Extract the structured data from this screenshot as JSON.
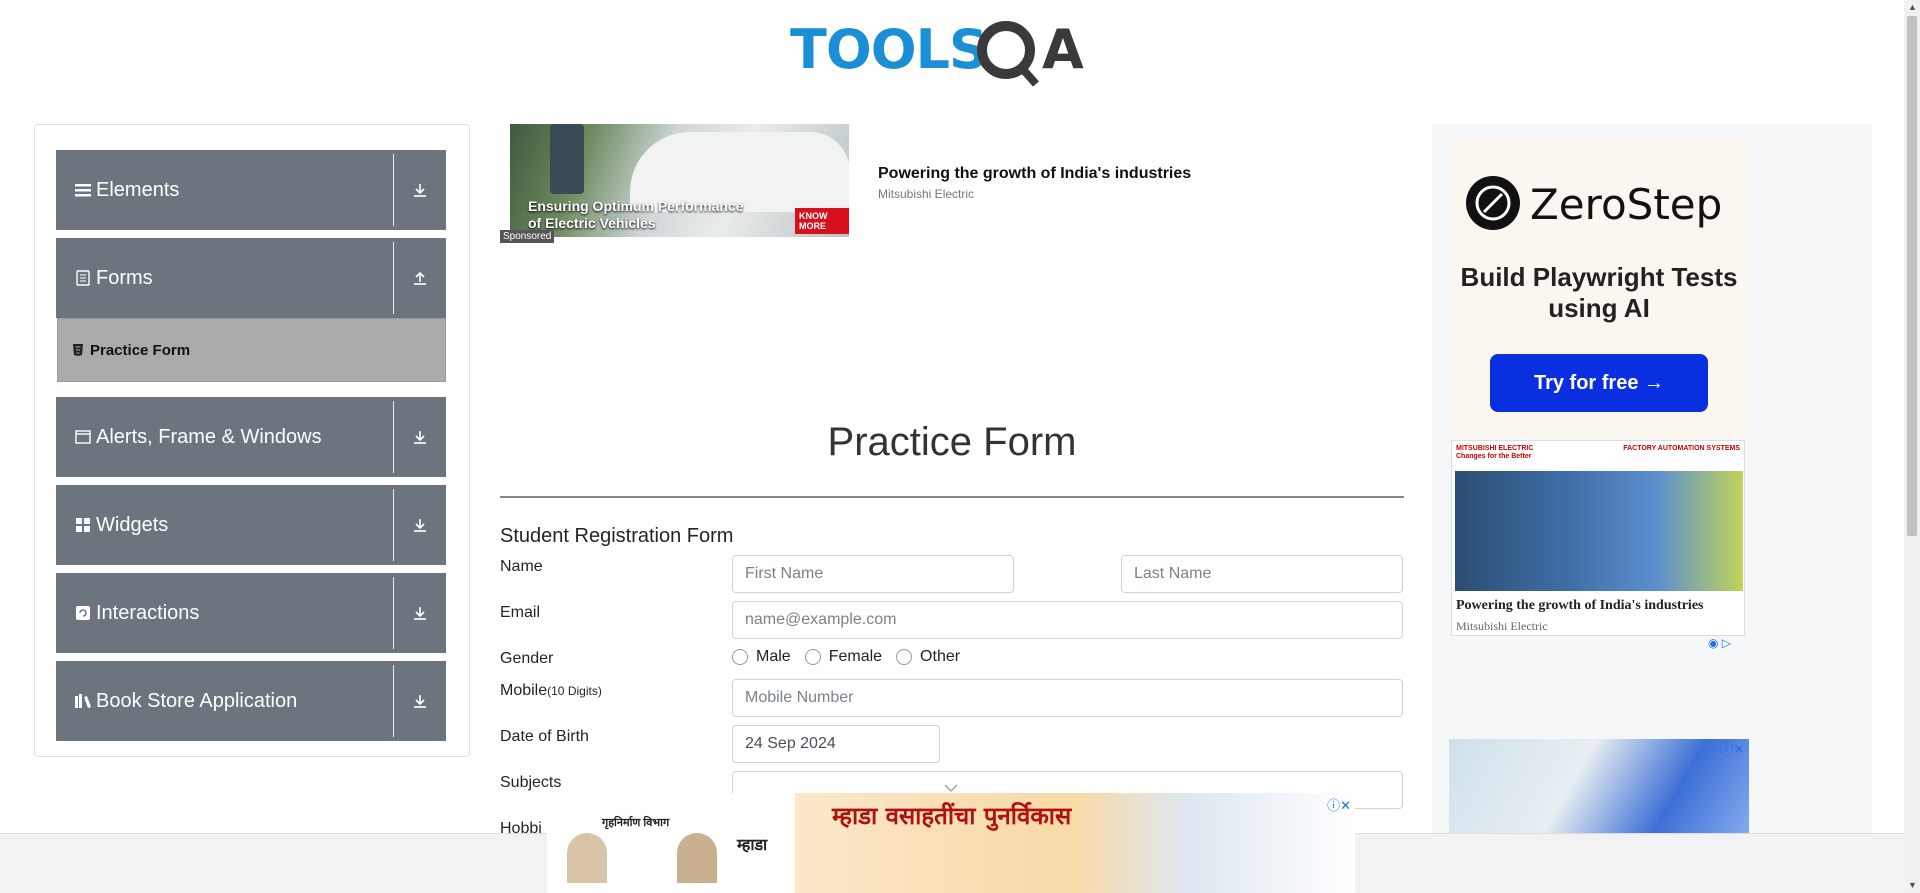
{
  "logo": {
    "text": "TOOLSQA"
  },
  "sidebar": {
    "groups": [
      {
        "label": "Elements",
        "icon": "hamburger-icon"
      },
      {
        "label": "Forms",
        "icon": "document-icon"
      },
      {
        "label": "Alerts, Frame & Windows",
        "icon": "window-icon"
      },
      {
        "label": "Widgets",
        "icon": "grid-icon"
      },
      {
        "label": "Interactions",
        "icon": "refresh-icon"
      },
      {
        "label": "Book Store Application",
        "icon": "books-icon"
      }
    ],
    "active_item": {
      "label": "Practice Form",
      "icon": "html-icon"
    }
  },
  "top_ad": {
    "caption": "Ensuring Optimum Performance of Electric Vehicles",
    "button": "KNOW MORE",
    "sponsored": "Sponsored",
    "title": "Powering the growth of India's industries",
    "brand": "Mitsubishi Electric"
  },
  "form": {
    "page_title": "Practice Form",
    "heading": "Student Registration Form",
    "name_label": "Name",
    "first_name_placeholder": "First Name",
    "last_name_placeholder": "Last Name",
    "email_label": "Email",
    "email_placeholder": "name@example.com",
    "gender_label": "Gender",
    "gender_options": [
      "Male",
      "Female",
      "Other"
    ],
    "mobile_label": "Mobile",
    "mobile_hint": "(10 Digits)",
    "mobile_placeholder": "Mobile Number",
    "dob_label": "Date of Birth",
    "dob_value": "24 Sep 2024",
    "subjects_label": "Subjects",
    "hobbies_label": "Hobbi"
  },
  "right_ads": {
    "zerostep_name": "ZeroStep",
    "zerostep_tagline": "Build Playwright Tests using AI",
    "zerostep_button": "Try for free →",
    "mitsu_logo": "MITSUBISHI ELECTRIC",
    "mitsu_slogan": "Changes for the Better",
    "mitsu_fa": "FACTORY AUTOMATION SYSTEMS",
    "mitsu_title": "Powering the growth of India's industries",
    "mitsu_brand": "Mitsubishi Electric"
  },
  "bottom_ad": {
    "headline": "म्हाडा वसाहतींचा पुनर्विकास",
    "dept": "गृहनिर्माण विभाग",
    "org": "म्हाडा"
  },
  "colors": {
    "sidebar_header": "#6c757d",
    "sidebar_active": "#aaaaaa",
    "zerostep_button": "#0a2fe0",
    "logo_blue": "#1b8fd6",
    "logo_dark": "#3a3a3a"
  }
}
